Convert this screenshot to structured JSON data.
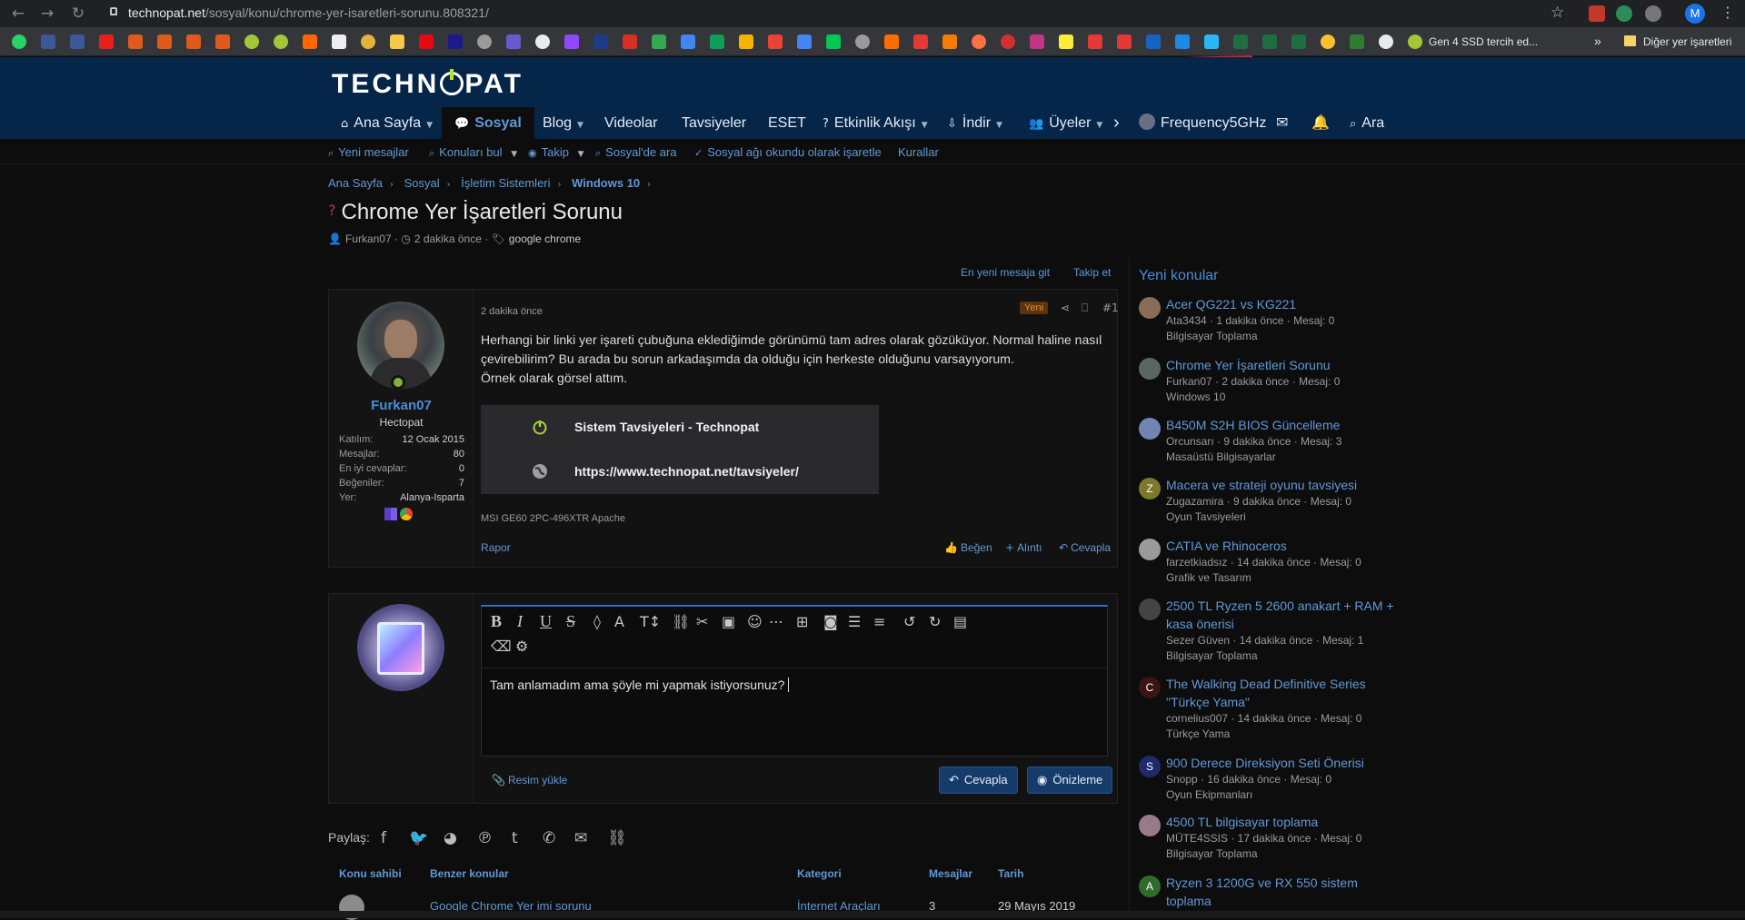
{
  "browser": {
    "url_host": "technopat.net",
    "url_path": "/sosyal/konu/chrome-yer-isaretleri-sorunu.808321/",
    "profile_initial": "M",
    "bookmark_label": "Gen 4 SSD tercih ed...",
    "bookmark_more": "»",
    "other_bookmarks": "Diğer yer işaretleri"
  },
  "site": {
    "logo_left": "TECHN",
    "logo_right": "PAT",
    "nav": {
      "home": "Ana Sayfa",
      "social": "Sosyal",
      "blog": "Blog",
      "videos": "Videolar",
      "advice": "Tavsiyeler",
      "eset": "ESET",
      "activity": "Etkinlik Akışı",
      "download": "İndir",
      "members": "Üyeler",
      "user": "Frequency5GHz",
      "search": "Ara"
    },
    "subnav": {
      "new_messages": "Yeni mesajlar",
      "find_threads": "Konuları bul",
      "watch": "Takip",
      "search_social": "Sosyal'de ara",
      "mark_read": "Sosyal ağı okundu olarak işaretle",
      "rules": "Kurallar"
    }
  },
  "breadcrumb": [
    "Ana Sayfa",
    "Sosyal",
    "İşletim Sistemleri",
    "Windows 10"
  ],
  "thread": {
    "title": "Chrome Yer İşaretleri Sorunu",
    "author": "Furkan07",
    "time": "2 dakika önce",
    "tag": "google chrome",
    "latest_link": "En yeni mesaja git",
    "watch_link": "Takip et"
  },
  "post": {
    "username": "Furkan07",
    "role": "Hectopat",
    "stats": [
      {
        "label": "Katılım:",
        "value": "12 Ocak 2015"
      },
      {
        "label": "Mesajlar:",
        "value": "80"
      },
      {
        "label": "En iyi cevaplar:",
        "value": "0"
      },
      {
        "label": "Beğeniler:",
        "value": "7"
      },
      {
        "label": "Yer:",
        "value": "Alanya-Isparta"
      }
    ],
    "time": "2 dakika önce",
    "badge": "Yeni",
    "number": "#1",
    "body_1": "Herhangi bir linki yer işareti çubuğuna eklediğimde görünümü tam adres olarak gözüküyor. Normal haline nasıl çevirebilirim? Bu arada bu sorun arkadaşımda da olduğu için herkeste olduğunu varsayıyorum.",
    "body_2": "Örnek olarak görsel attım.",
    "embed_title": "Sistem Tavsiyeleri - Technopat",
    "embed_url": "https://www.technopat.net/tavsiyeler/",
    "signature": "MSI GE60 2PC-496XTR Apache",
    "report": "Rapor",
    "like": "Beğen",
    "quote": "Alıntı",
    "reply": "Cevapla"
  },
  "reply_box": {
    "text": "Tam anlamadım ama şöyle mi yapmak istiyorsunuz?",
    "upload": "Resim yükle",
    "submit": "Cevapla",
    "preview": "Önizleme"
  },
  "share_label": "Paylaş:",
  "similar": {
    "headers": [
      "Konu sahibi",
      "Benzer konular",
      "Kategori",
      "Mesajlar",
      "Tarih"
    ],
    "row": {
      "title": "Google Chrome Yer imi sorunu",
      "category": "İnternet Araçları",
      "messages": "3",
      "date": "29 Mayıs 2019"
    }
  },
  "sidebar": {
    "title": "Yeni konular",
    "items": [
      {
        "title": "Acer QG221 vs KG221",
        "meta": "Ata3434 · 1 dakika önce · Mesaj: 0",
        "category": "Bilgisayar Toplama",
        "avatar": "",
        "color": "#8a6b55"
      },
      {
        "title": "Chrome Yer İşaretleri Sorunu",
        "meta": "Furkan07 · 2 dakika önce · Mesaj: 0",
        "category": "Windows 10",
        "avatar": "",
        "color": "#5c6660"
      },
      {
        "title": "B450M S2H BIOS Güncelleme",
        "meta": "Orcunsarı · 9 dakika önce · Mesaj: 3",
        "category": "Masaüstü Bilgisayarlar",
        "avatar": "",
        "color": "#6f86b3"
      },
      {
        "title": "Macera ve strateji oyunu tavsiyesi",
        "meta": "Zugazamira · 9 dakika önce · Mesaj: 0",
        "category": "Oyun Tavsiyeleri",
        "avatar": "Z",
        "color": "#7c7a2a"
      },
      {
        "title": "CATIA ve Rhinoceros",
        "meta": "farzetkiadsız · 14 dakika önce · Mesaj: 0",
        "category": "Grafik ve Tasarım",
        "avatar": "",
        "color": "#9a9a9a"
      },
      {
        "title": "2500 TL Ryzen 5 2600 anakart + RAM + kasa önerisi",
        "meta": "Sezer Güven · 14 dakika önce · Mesaj: 1",
        "category": "Bilgisayar Toplama",
        "avatar": "",
        "color": "#444444"
      },
      {
        "title": "The Walking Dead Definitive Series \"Türkçe Yama\"",
        "meta": "cornelius007 · 14 dakika önce · Mesaj: 0",
        "category": "Türkçe Yama",
        "avatar": "C",
        "color": "#3b1414"
      },
      {
        "title": "900 Derece Direksiyon Seti Önerisi",
        "meta": "Snopp · 16 dakika önce · Mesaj: 0",
        "category": "Oyun Ekipmanları",
        "avatar": "S",
        "color": "#1e2a6b"
      },
      {
        "title": "4500 TL bilgisayar toplama",
        "meta": "MÜTE4SSIS · 17 dakika önce · Mesaj: 0",
        "category": "Bilgisayar Toplama",
        "avatar": "",
        "color": "#9a7a88"
      },
      {
        "title": "Ryzen 3 1200G ve RX 550 sistem toplama",
        "meta": "",
        "category": "",
        "avatar": "A",
        "color": "#2f6b2a"
      }
    ]
  }
}
